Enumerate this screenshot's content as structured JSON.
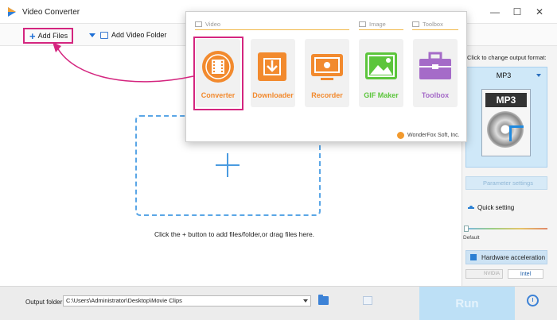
{
  "window": {
    "title": "Video Converter",
    "controls": {
      "minimize": "—",
      "maximize": "☐",
      "close": "✕"
    }
  },
  "toolbar": {
    "add_files": "Add Files",
    "add_video_folder": "Add Video Folder"
  },
  "workspace": {
    "drop_hint": "Click the + button to add files/folder,or drag files here."
  },
  "popup": {
    "sections": {
      "video": "Video",
      "image": "Image",
      "toolbox": "Toolbox"
    },
    "tools": [
      {
        "label": "Converter",
        "icon": "film-icon",
        "color": "#f28a2e"
      },
      {
        "label": "Downloader",
        "icon": "download-icon",
        "color": "#f28a2e"
      },
      {
        "label": "Recorder",
        "icon": "screen-record-icon",
        "color": "#f28a2e"
      },
      {
        "label": "GIF Maker",
        "icon": "image-icon",
        "color": "#5cc53c"
      },
      {
        "label": "Toolbox",
        "icon": "toolbox-icon",
        "color": "#a56bc8"
      }
    ],
    "footer": "WonderFox Soft, Inc."
  },
  "right_panel": {
    "hint": "Click to change output format:",
    "format": "MP3",
    "format_badge": "MP3",
    "parameter_settings": "Parameter settings",
    "quick_setting": "Quick setting",
    "default_label": "Default",
    "hardware_acceleration": "Hardware acceleration",
    "gpu_nvidia": "NVIDIA",
    "gpu_intel": "Intel"
  },
  "bottom": {
    "output_label": "Output folder:",
    "output_path": "C:\\Users\\Administrator\\Desktop\\Movie Clips",
    "run": "Run"
  },
  "colors": {
    "accent": "#1e6fd6",
    "highlight": "#d4257f",
    "run_button": "#bde0f6",
    "format_card": "#cfe8f8"
  }
}
